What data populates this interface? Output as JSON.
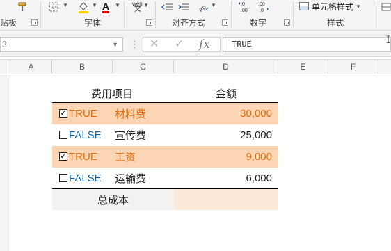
{
  "ribbon": {
    "groups": [
      {
        "label": "贴板"
      },
      {
        "label": "字体"
      },
      {
        "label": "对齐方式"
      },
      {
        "label": "数字"
      },
      {
        "label": "样式"
      }
    ],
    "wen_top": "wén",
    "wen_bottom": "文",
    "decimal_inc": "←.0\n.00",
    "decimal_dec": ".00\n→.0",
    "styles_button": "单元格样式"
  },
  "formula_bar": {
    "name_box": "3",
    "fx_label": "fx",
    "cancel": "✕",
    "enter": "✓",
    "content": "TRUE"
  },
  "columns": [
    "A",
    "B",
    "C",
    "D",
    "E",
    "F"
  ],
  "table": {
    "header_item": "费用项目",
    "header_amount": "金额",
    "rows": [
      {
        "checked": true,
        "bool": "TRUE",
        "item": "材料费",
        "amount": "30,000"
      },
      {
        "checked": false,
        "bool": "FALSE",
        "item": "宣传费",
        "amount": "25,000"
      },
      {
        "checked": true,
        "bool": "TRUE",
        "item": "工资",
        "amount": "9,000"
      },
      {
        "checked": false,
        "bool": "FALSE",
        "item": "运输费",
        "amount": "6,000"
      }
    ],
    "total_label": "总成本",
    "total_value": "",
    "check_mark": "✓"
  },
  "colors": {
    "highlight": "#fcd5b4",
    "true_text": "#e46c0a",
    "false_text": "#0b62a4",
    "total_label_bg": "#f2f2f2",
    "total_value_bg": "#fde9d9"
  }
}
